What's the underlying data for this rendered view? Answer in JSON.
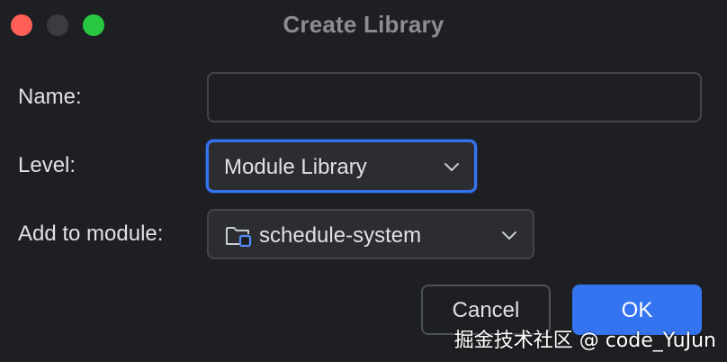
{
  "window": {
    "title": "Create Library",
    "controls": [
      "close",
      "minimize",
      "zoom"
    ]
  },
  "form": {
    "name": {
      "label": "Name:",
      "value": "",
      "placeholder": ""
    },
    "level": {
      "label": "Level:",
      "selected": "Module Library",
      "focused": true
    },
    "module": {
      "label": "Add to module:",
      "selected": "schedule-system",
      "icon": "module-folder-icon"
    }
  },
  "buttons": {
    "cancel_label": "Cancel",
    "ok_label": "OK"
  },
  "watermark": "掘金技术社区 @ code_YuJun",
  "colors": {
    "background": "#1e1f22",
    "accent": "#3574f0",
    "close": "#ff5f57",
    "zoom": "#28c840",
    "text": "#dfe1e5"
  }
}
